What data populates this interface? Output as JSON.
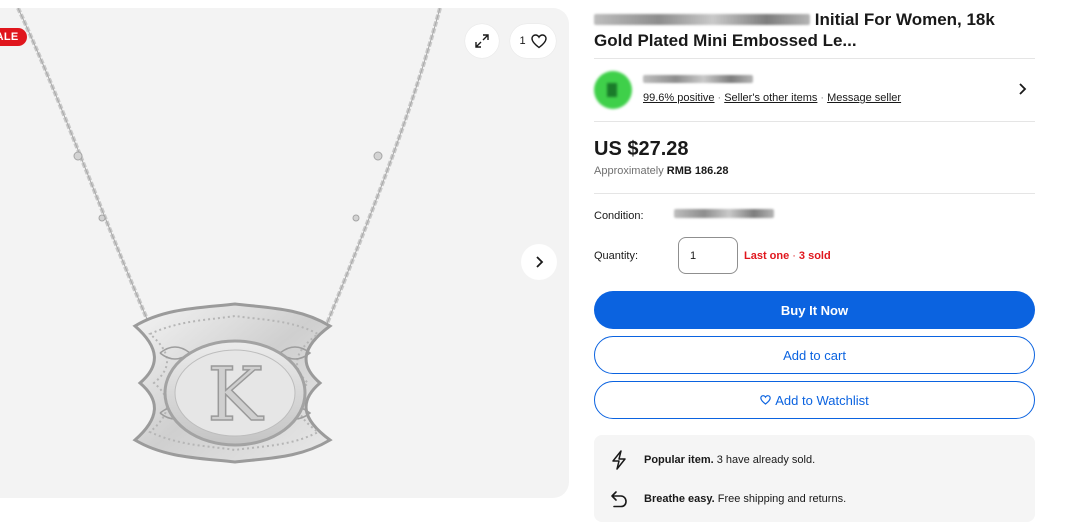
{
  "gallery": {
    "sale_badge": "SALE",
    "watch_count": "1",
    "icons": [
      "expand-icon",
      "heart-icon",
      "chevron-right-icon"
    ],
    "pendant_letter": "K"
  },
  "listing": {
    "title_visible": "Initial For Women, 18k Gold Plated Mini Embossed Le...",
    "title_line1_tail": "Initial For Women, 18k",
    "title_line2": "Gold Plated Mini Embossed Le..."
  },
  "seller": {
    "feedback": "99.6% positive",
    "separator": "·",
    "other_items": "Seller's other items",
    "message": "Message seller"
  },
  "price": {
    "main": "US $27.28",
    "approx_prefix": "Approximately",
    "approx_value": "RMB 186.28"
  },
  "details": {
    "condition_label": "Condition:",
    "quantity_label": "Quantity:",
    "quantity_value": "1",
    "last_one": "Last one",
    "sold": "3 sold"
  },
  "actions": {
    "buy_now": "Buy It Now",
    "add_to_cart": "Add to cart",
    "add_to_watchlist": "Add to Watchlist"
  },
  "promos": [
    {
      "icon": "lightning-icon",
      "bold": "Popular item.",
      "text": "3 have already sold."
    },
    {
      "icon": "return-arrow-icon",
      "bold": "Breathe easy.",
      "text": "Free shipping and returns."
    }
  ],
  "colors": {
    "accent": "#0b63e0",
    "sale": "#e0161d",
    "gallery_bg": "#f3f3f3"
  }
}
